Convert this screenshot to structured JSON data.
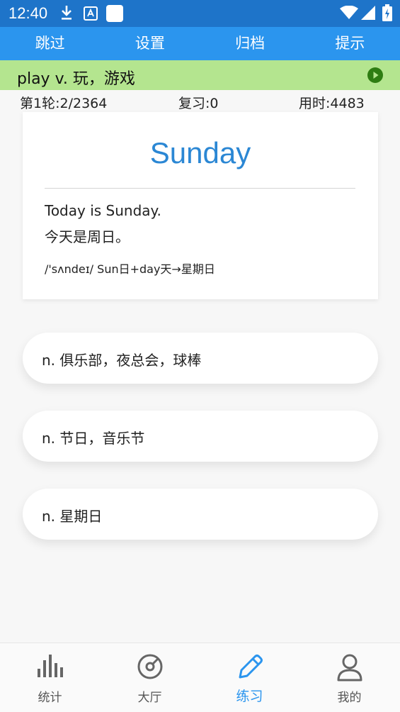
{
  "status_bar": {
    "time": "12:40",
    "icons": [
      "download-icon",
      "translate-app-icon",
      "app-square-icon",
      "wifi-icon",
      "cellular-icon",
      "battery-icon"
    ]
  },
  "top_nav": {
    "items": [
      {
        "label": "跳过"
      },
      {
        "label": "设置"
      },
      {
        "label": "归档"
      },
      {
        "label": "提示"
      }
    ]
  },
  "word_bar": {
    "text": "play  v. 玩，游戏",
    "play_icon": "play-circle-icon",
    "bg_color": "#b4e58f",
    "icon_color": "#2e7d12"
  },
  "stats": {
    "round": "第1轮:2/2364",
    "review": "复习:0",
    "time_used": "用时:4483"
  },
  "card": {
    "headword": "Sunday",
    "sentence_en": "Today is Sunday.",
    "sentence_zh": "今天是周日。",
    "note": "/'sʌndeɪ/   Sun日+day天→星期日"
  },
  "options": [
    {
      "text": "n. 俱乐部，夜总会，球棒"
    },
    {
      "text": "n. 节日，音乐节"
    },
    {
      "text": "n. 星期日"
    }
  ],
  "tabs": [
    {
      "label": "统计",
      "icon": "bar-chart-icon"
    },
    {
      "label": "大厅",
      "icon": "gauge-icon"
    },
    {
      "label": "练习",
      "icon": "pencil-icon",
      "active": true
    },
    {
      "label": "我的",
      "icon": "person-icon"
    }
  ],
  "colors": {
    "status_bar": "#1e74c9",
    "nav_bar": "#2b95ee",
    "accent": "#2b95ee",
    "headword": "#2b87d4"
  }
}
